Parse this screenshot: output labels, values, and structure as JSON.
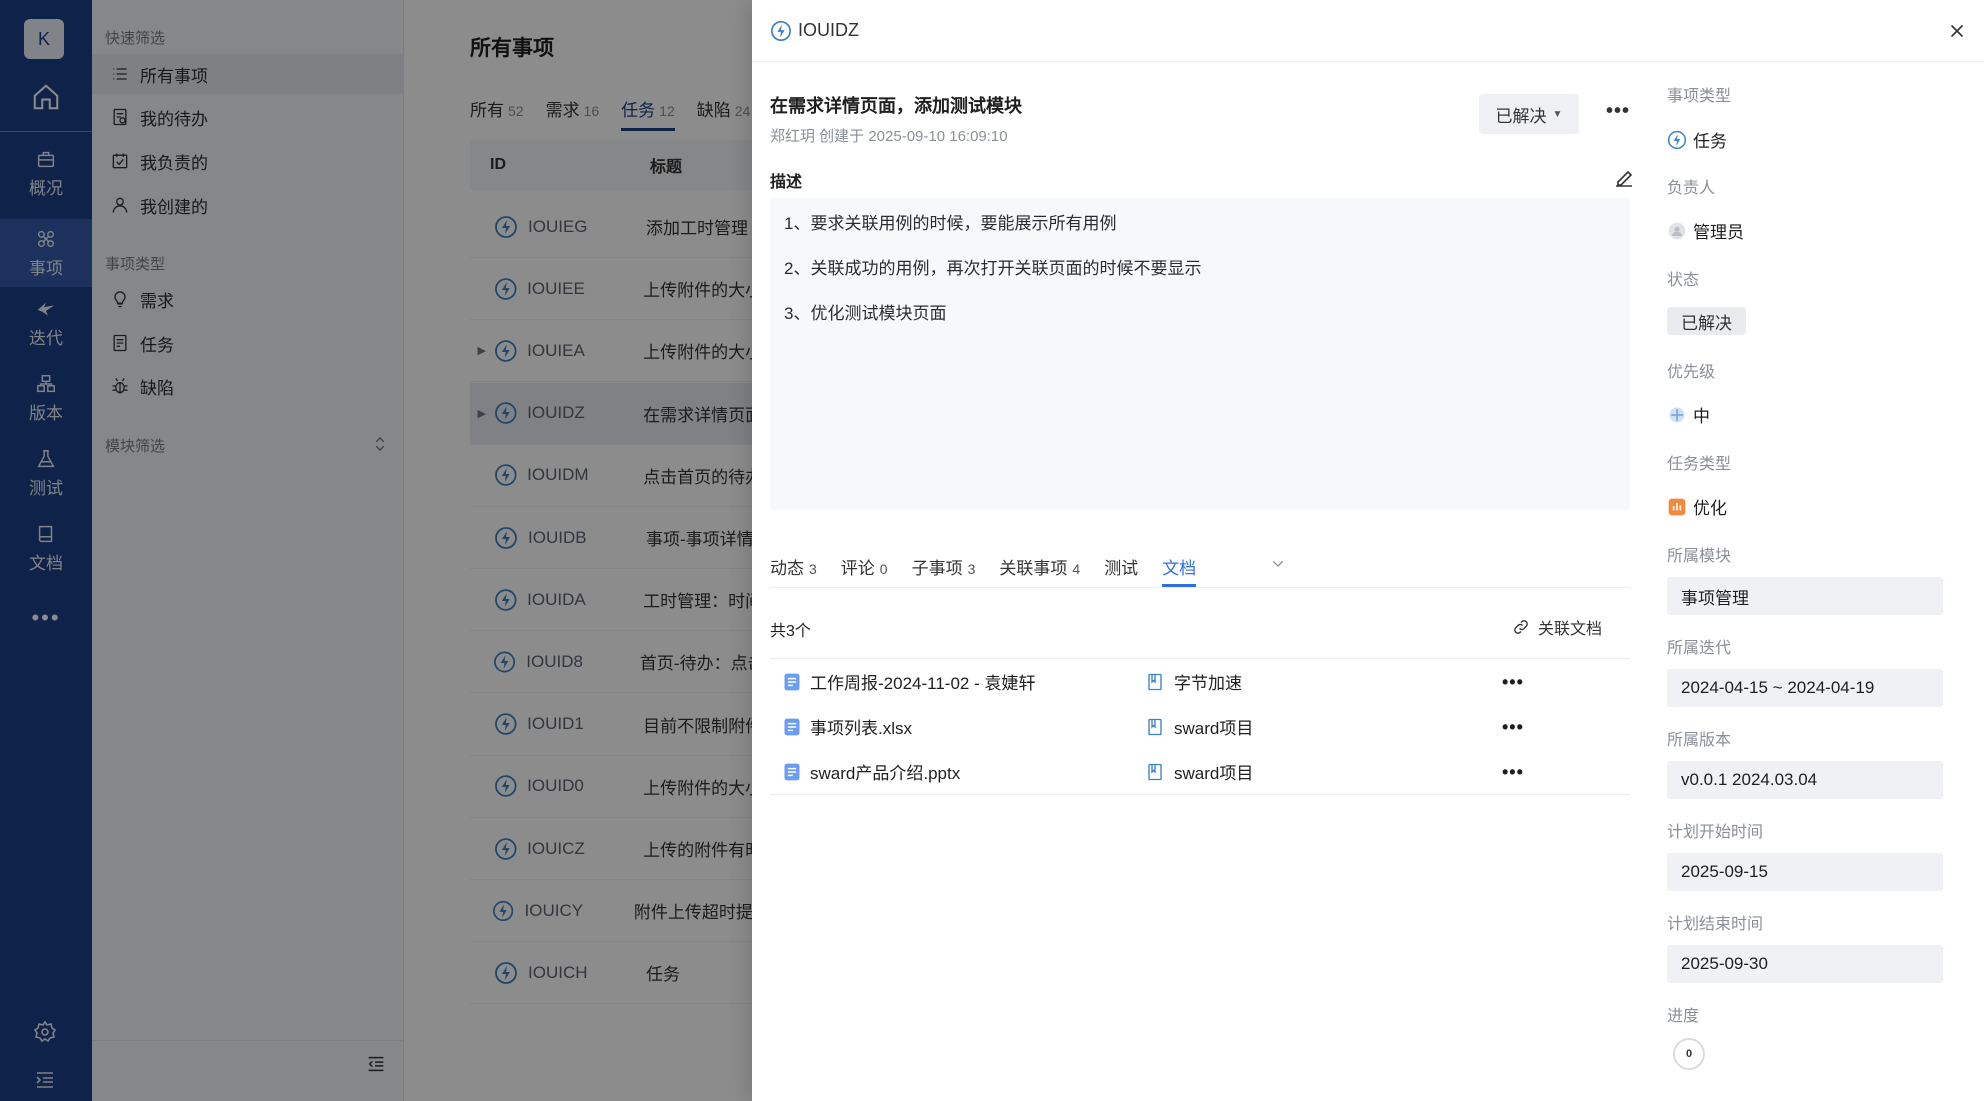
{
  "nav": {
    "avatar": "K",
    "items": [
      {
        "label": "概况",
        "icon": "briefcase-icon"
      },
      {
        "label": "事项",
        "icon": "issue-icon"
      },
      {
        "label": "迭代",
        "icon": "sprint-icon"
      },
      {
        "label": "版本",
        "icon": "version-icon"
      },
      {
        "label": "测试",
        "icon": "flask-icon"
      },
      {
        "label": "文档",
        "icon": "book-icon"
      }
    ],
    "more": "•••"
  },
  "sidebar": {
    "quick_filter_title": "快速筛选",
    "quick_items": [
      "所有事项",
      "我的待办",
      "我负责的",
      "我创建的"
    ],
    "type_title": "事项类型",
    "type_items": [
      "需求",
      "任务",
      "缺陷"
    ],
    "module_title": "模块筛选"
  },
  "list": {
    "title": "所有事项",
    "tabs": [
      {
        "label": "所有",
        "count": "52"
      },
      {
        "label": "需求",
        "count": "16"
      },
      {
        "label": "任务",
        "count": "12"
      },
      {
        "label": "缺陷",
        "count": "24"
      }
    ],
    "columns": [
      "ID",
      "标题"
    ],
    "rows": [
      {
        "id": "IOUIEG",
        "title": "添加工时管理",
        "expandable": false
      },
      {
        "id": "IOUIEE",
        "title": "上传附件的大小",
        "expandable": false
      },
      {
        "id": "IOUIEA",
        "title": "上传附件的大小",
        "expandable": true
      },
      {
        "id": "IOUIDZ",
        "title": "在需求详情页面",
        "expandable": true
      },
      {
        "id": "IOUIDM",
        "title": "点击首页的待办",
        "expandable": false
      },
      {
        "id": "IOUIDB",
        "title": "事项-事项详情",
        "expandable": false
      },
      {
        "id": "IOUIDA",
        "title": "工时管理：时间",
        "expandable": false
      },
      {
        "id": "IOUID8",
        "title": "首页-待办：点击",
        "expandable": false
      },
      {
        "id": "IOUID1",
        "title": "目前不限制附件",
        "expandable": false
      },
      {
        "id": "IOUID0",
        "title": "上传附件的大小",
        "expandable": false
      },
      {
        "id": "IOUICZ",
        "title": "上传的附件有时",
        "expandable": false
      },
      {
        "id": "IOUICY",
        "title": "附件上传超时提示",
        "expandable": false
      },
      {
        "id": "IOUICH",
        "title": "任务",
        "expandable": false
      }
    ]
  },
  "drawer": {
    "id": "IOUIDZ",
    "title": "在需求详情页面，添加测试模块",
    "meta": "郑红玥 创建于 2025-09-10 16:09:10",
    "status_button": "已解决",
    "desc_label": "描述",
    "description": [
      "1、要求关联用例的时候，要能展示所有用例",
      "2、关联成功的用例，再次打开关联页面的时候不要显示",
      "3、优化测试模块页面"
    ],
    "tabs": [
      {
        "label": "动态",
        "count": "3"
      },
      {
        "label": "评论",
        "count": "0"
      },
      {
        "label": "子事项",
        "count": "3"
      },
      {
        "label": "关联事项",
        "count": "4"
      },
      {
        "label": "测试",
        "count": ""
      },
      {
        "label": "文档",
        "count": ""
      }
    ],
    "doc_total": "共3个",
    "link_doc": "关联文档",
    "docs": [
      {
        "name": "工作周报-2024-11-02 - 袁婕轩",
        "repo": "字节加速"
      },
      {
        "name": "事项列表.xlsx",
        "repo": "sward项目"
      },
      {
        "name": "sward产品介绍.pptx",
        "repo": "sward项目"
      }
    ],
    "fields": {
      "type_label": "事项类型",
      "type_value": "任务",
      "owner_label": "负责人",
      "owner_value": "管理员",
      "state_label": "状态",
      "state_value": "已解决",
      "priority_label": "优先级",
      "priority_value": "中",
      "task_type_label": "任务类型",
      "task_type_value": "优化",
      "module_label": "所属模块",
      "module_value": "事项管理",
      "sprint_label": "所属迭代",
      "sprint_value": "2024-04-15 ~ 2024-04-19",
      "version_label": "所属版本",
      "version_value": "v0.0.1 2024.03.04",
      "plan_start_label": "计划开始时间",
      "plan_start_value": "2025-09-15",
      "plan_end_label": "计划结束时间",
      "plan_end_value": "2025-09-30",
      "progress_label": "进度",
      "progress_value": "0"
    }
  },
  "colors": {
    "nav_bg": "#1d3f87",
    "nav_active": "#3459a7",
    "task_icon": "#3b82c4",
    "link_blue": "#2f6fe4",
    "doc_icon": "#6b9ef2",
    "optimize_orange": "#f08a3c"
  }
}
